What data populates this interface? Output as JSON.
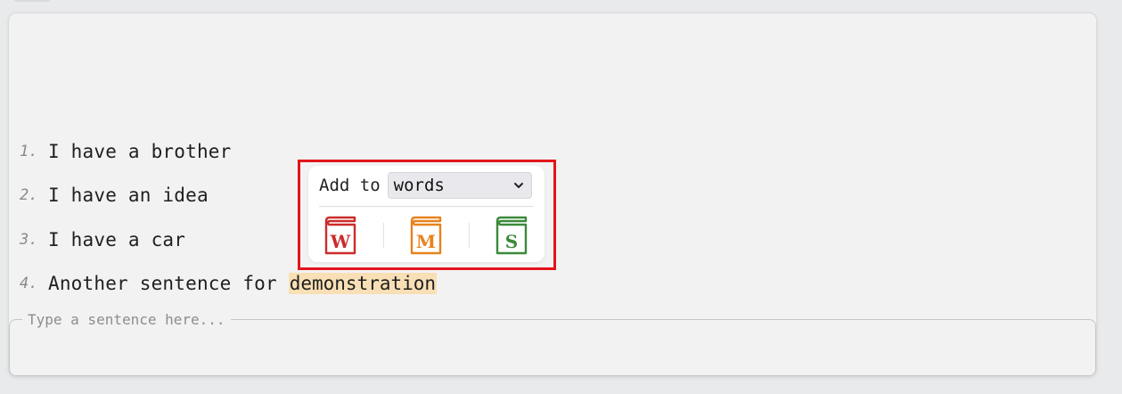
{
  "sentences": [
    {
      "number": "1.",
      "text": "I have a brother"
    },
    {
      "number": "2.",
      "text": "I have an idea"
    },
    {
      "number": "3.",
      "text": "I have a car"
    },
    {
      "number": "4.",
      "text_before": "Another sentence for ",
      "highlighted_word": "demonstration"
    }
  ],
  "input": {
    "placeholder": "Type a sentence here...",
    "value": ""
  },
  "popup": {
    "add_to_label": "Add to",
    "list_selected": "words",
    "dictionaries": [
      {
        "letter": "W",
        "color": "#cc2b2b",
        "icon": "book-w-icon"
      },
      {
        "letter": "M",
        "color": "#e8821e",
        "icon": "book-m-icon"
      },
      {
        "letter": "S",
        "color": "#3a8a3a",
        "icon": "book-s-icon"
      }
    ]
  },
  "colors": {
    "highlight": "#f9dfb5",
    "selection_outline": "#e3141b"
  }
}
